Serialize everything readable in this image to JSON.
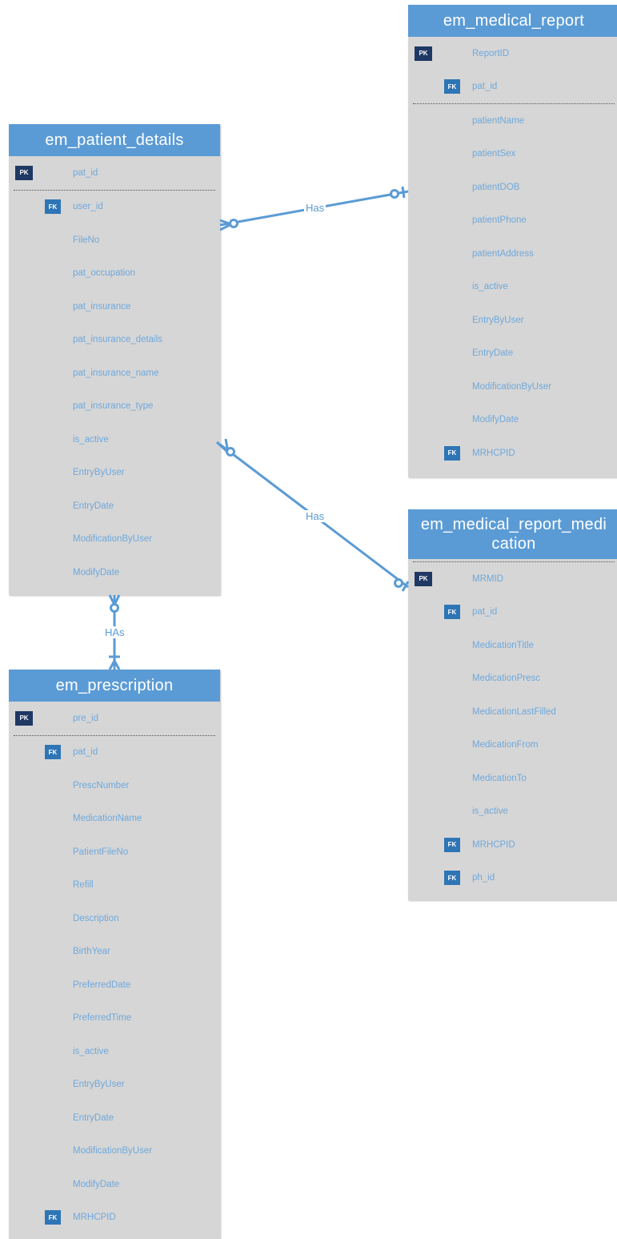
{
  "colors": {
    "header": "#5b9bd5",
    "body": "#d6d6d6",
    "field_text": "#6fa8dc",
    "pk_badge": "#1f3864",
    "fk_badge": "#2e75b6",
    "line": "#5b9bd5"
  },
  "badges": {
    "pk": "PK",
    "fk": "FK"
  },
  "entities": {
    "patient_details": {
      "title": "em_patient_details",
      "pk_field": "pat_id",
      "fields": [
        "user_id",
        "FileNo",
        "pat_occupation",
        "pat_insurance",
        "pat_insurance_details",
        "pat_insurance_name",
        "pat_insurance_type",
        "is_active",
        "EntryByUser",
        "EntryDate",
        "ModificationByUser",
        "ModifyDate"
      ]
    },
    "medical_report": {
      "title": "em_medical_report",
      "pk_field": "ReportID",
      "fields": [
        "pat_id",
        "patientName",
        "patientSex",
        "patientDOB",
        "patientPhone",
        "patientAddress",
        "is_active",
        "EntryByUser",
        "EntryDate",
        "ModificationByUser",
        "ModifyDate",
        "MRHCPID"
      ]
    },
    "prescription": {
      "title": "em_prescription",
      "pk_field": "pre_id",
      "fields": [
        "pat_id",
        "PrescNumber",
        "MedicationName",
        "PatientFileNo",
        "Refill",
        "Description",
        "BirthYear",
        "PreferredDate",
        "PreferredTime",
        "is_active",
        "EntryByUser",
        "EntryDate",
        "ModificationByUser",
        "ModifyDate",
        "MRHCPID"
      ]
    },
    "medical_report_medication": {
      "title_line1": "em_medical_report_medi",
      "title_line2": "cation",
      "pk_field": "MRMID",
      "fields": [
        "pat_id",
        "MedicationTitle",
        "MedicationPresc",
        "MedicationLastFilled",
        "MedicationFrom",
        "MedicationTo",
        "is_active",
        "MRHCPID",
        "ph_id"
      ]
    }
  },
  "relationships": {
    "details_report": "Has",
    "details_medication": "Has",
    "details_prescription": "HAs"
  }
}
